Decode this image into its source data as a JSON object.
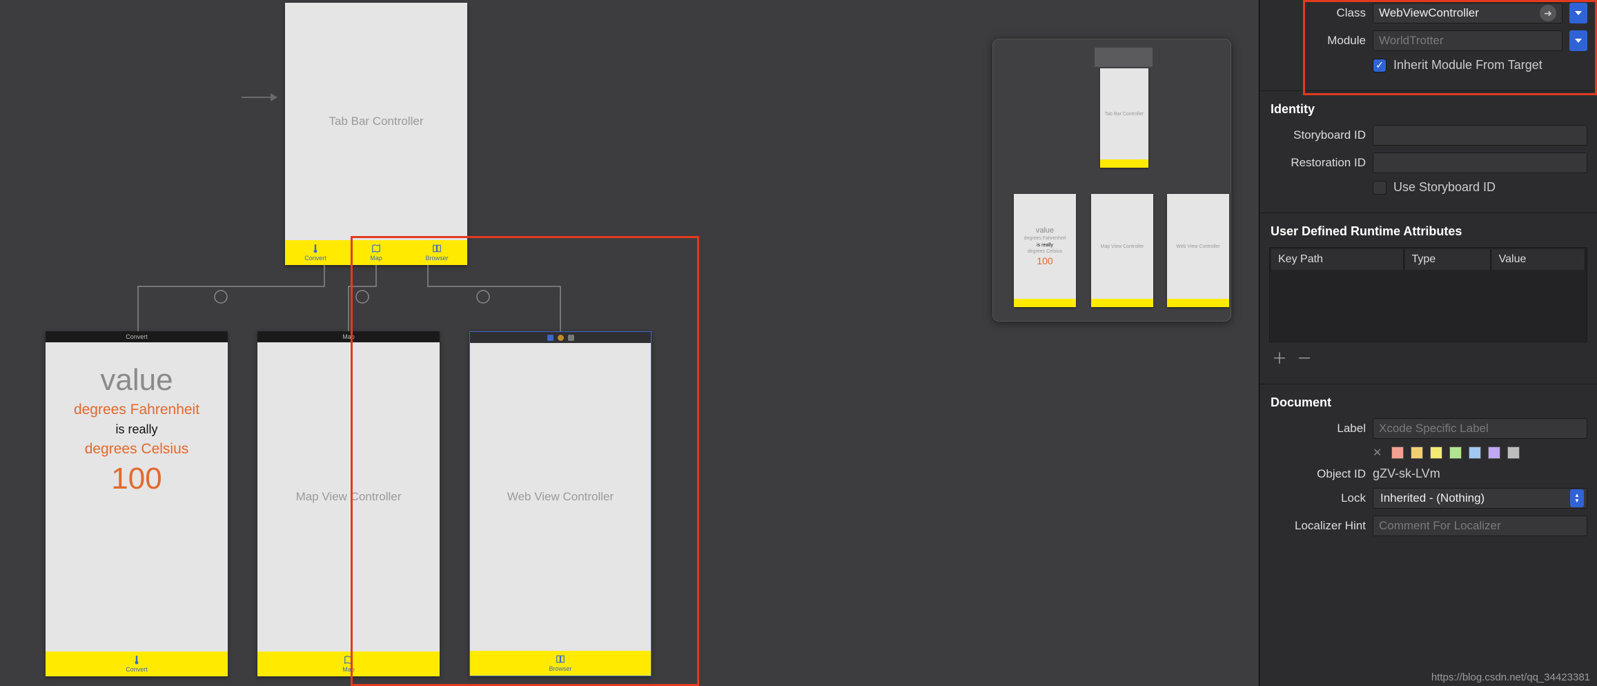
{
  "canvas": {
    "tabController": {
      "title": "Tab Bar Controller",
      "tabs": [
        "Convert",
        "Map",
        "Browser"
      ]
    },
    "scenes": {
      "convert": {
        "header": "Convert",
        "value": "value",
        "line1": "degrees Fahrenheit",
        "line2": "is really",
        "line3": "degrees Celsius",
        "result": "100",
        "tab": "Convert"
      },
      "map": {
        "header": "Map",
        "body": "Map View Controller",
        "tab": "Map"
      },
      "web": {
        "header": "",
        "body": "Web View Controller",
        "tab": "Browser"
      }
    }
  },
  "overview": {
    "top": "Tab Bar Controller",
    "c1": {
      "value": "value",
      "l1": "degrees Fahrenheit",
      "l2": "is really",
      "l3": "degrees Celsius",
      "r": "100"
    },
    "c2": "Map View Controller",
    "c3": "Web View Controller"
  },
  "inspector": {
    "customClass": {
      "classLabel": "Class",
      "classValue": "WebViewController",
      "moduleLabel": "Module",
      "modulePlaceholder": "WorldTrotter",
      "inheritLabel": "Inherit Module From Target"
    },
    "identity": {
      "title": "Identity",
      "storyboardLabel": "Storyboard ID",
      "restorationLabel": "Restoration ID",
      "useStoryboardLabel": "Use Storyboard ID"
    },
    "runtime": {
      "title": "User Defined Runtime Attributes",
      "cols": [
        "Key Path",
        "Type",
        "Value"
      ]
    },
    "document": {
      "title": "Document",
      "labelLabel": "Label",
      "labelPlaceholder": "Xcode Specific Label",
      "swatches": [
        "#f2a08f",
        "#f2cf73",
        "#f2ea73",
        "#b0e58f",
        "#9fc8f2",
        "#c0a8f2",
        "#bdbdbd"
      ],
      "objectIdLabel": "Object ID",
      "objectIdValue": "gZV-sk-LVm",
      "lockLabel": "Lock",
      "lockValue": "Inherited - (Nothing)",
      "localizerLabel": "Localizer Hint",
      "localizerPlaceholder": "Comment For Localizer"
    }
  },
  "watermark": "https://blog.csdn.net/qq_34423381"
}
